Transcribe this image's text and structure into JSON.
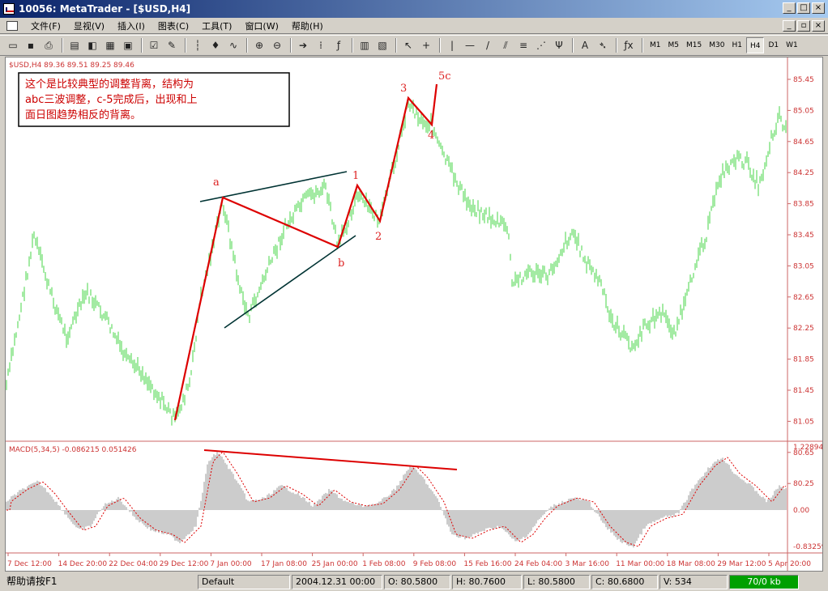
{
  "window": {
    "title": "10056: MetaTrader - [$USD,H4]"
  },
  "menu": {
    "items": [
      "文件(F)",
      "显视(V)",
      "插入(I)",
      "图表(C)",
      "工具(T)",
      "窗口(W)",
      "帮助(H)"
    ]
  },
  "toolbar": {
    "timeframes": [
      "M1",
      "M5",
      "M15",
      "M30",
      "H1",
      "H4",
      "D1",
      "W1"
    ],
    "active_timeframe": "H4"
  },
  "chart": {
    "header": "$USD,H4 89.36 89.51 89.25 89.46",
    "annotation_lines": [
      "这个是比较典型的调整背离，结构为",
      "abc三波调整，c-5完成后，出现和上",
      "面日图趋势相反的背离。"
    ],
    "wave_labels": [
      "a",
      "b",
      "1",
      "2",
      "3",
      "4",
      "5c"
    ],
    "price_axis": [
      "85.45",
      "85.05",
      "84.65",
      "84.25",
      "83.85",
      "83.45",
      "83.05",
      "82.65",
      "82.25",
      "81.85",
      "81.45",
      "81.05",
      "80.65",
      "80.25"
    ],
    "macd_label": "MACD(5,34,5) -0.086215 0.051426",
    "macd_axis": [
      "1.22894",
      "0.00",
      "-0.83259"
    ],
    "time_axis": [
      "7 Dec 12:00",
      "14 Dec 20:00",
      "22 Dec 04:00",
      "29 Dec 12:00",
      "7 Jan 00:00",
      "17 Jan 08:00",
      "25 Jan 00:00",
      "1 Feb 08:00",
      "9 Feb 08:00",
      "15 Feb 16:00",
      "24 Feb 04:00",
      "3 Mar 16:00",
      "11 Mar 00:00",
      "18 Mar 08:00",
      "29 Mar 12:00",
      "5 Apr 20:00"
    ],
    "colors": {
      "price": "#66dd66",
      "trend": "#dd0000",
      "channel": "#003333",
      "macd_hist": "#c0c0c0",
      "signal": "#dd0000",
      "axis": "#cc3333"
    }
  },
  "status": {
    "help": "帮助请按F1",
    "profile": "Default",
    "datetime": "2004.12.31 00:00",
    "open": "O: 80.5800",
    "high": "H: 80.7600",
    "low": "L: 80.5800",
    "close": "C: 80.6800",
    "volume": "V: 534",
    "traffic": "70/0 kb"
  }
}
